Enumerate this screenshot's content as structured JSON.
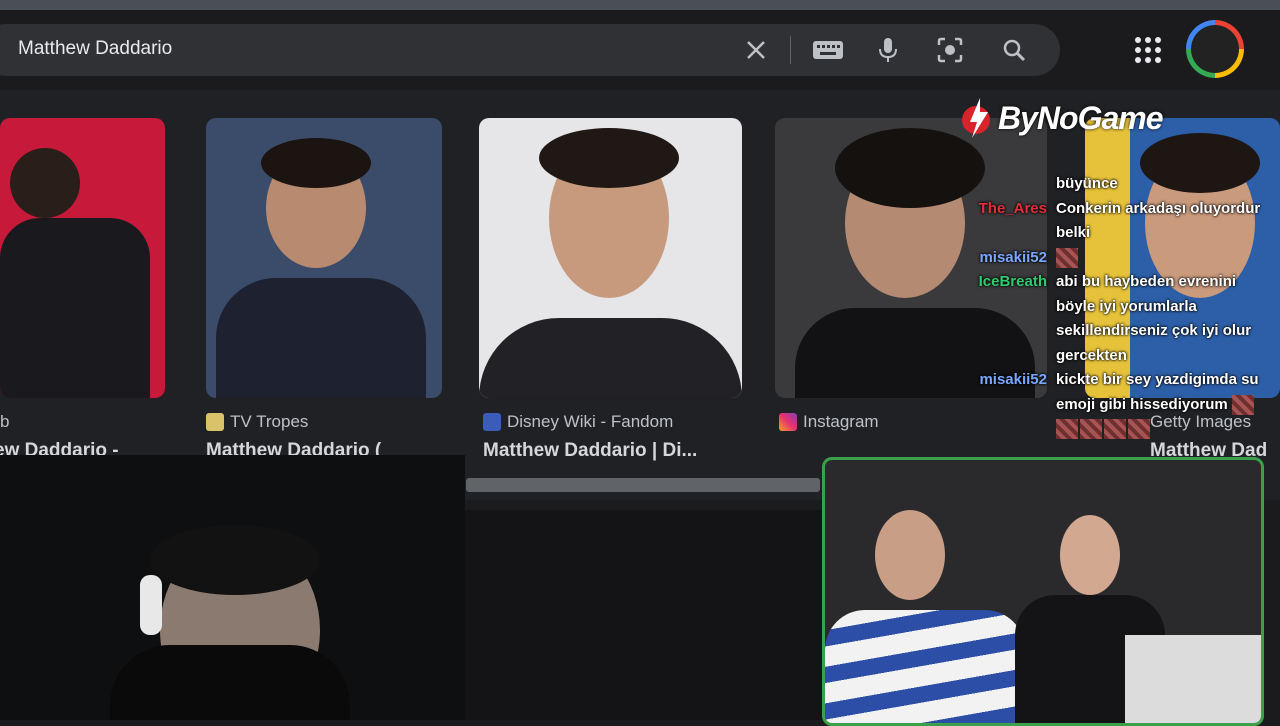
{
  "search": {
    "query": "Matthew Daddario",
    "icons": [
      "close-icon",
      "keyboard-icon",
      "mic-icon",
      "lens-icon",
      "search-icon"
    ]
  },
  "header": {
    "apps_icon": "apps-grid-icon"
  },
  "results": [
    {
      "source": "b",
      "title": "ew Daddario -"
    },
    {
      "source": "TV Tropes",
      "title": "Matthew Daddario ("
    },
    {
      "source": "Disney Wiki - Fandom",
      "title": "Matthew Daddario | Di..."
    },
    {
      "source": "Instagram",
      "title": ""
    },
    {
      "source": "Getty Images",
      "title": "Matthew Dad"
    }
  ],
  "overlay": {
    "logo": "ByNoGame"
  },
  "chat": [
    {
      "user": "",
      "message": "büyünce",
      "color": "#ffffff"
    },
    {
      "user": "The_Ares",
      "message": "Conkerin arkadaşı oluyordur",
      "color": "#e0303a"
    },
    {
      "user": "",
      "message": "belki",
      "color": "#ffffff"
    },
    {
      "user": "misakii52",
      "message": "",
      "color": "#7aa7ff",
      "emotes": 1
    },
    {
      "user": "IceBreath",
      "message": "abi bu haybeden evrenini",
      "color": "#2ecc71"
    },
    {
      "user": "",
      "message": "böyle iyi yorumlarla",
      "color": "#ffffff"
    },
    {
      "user": "",
      "message": "sekillendirseniz çok iyi olur",
      "color": "#ffffff"
    },
    {
      "user": "",
      "message": "gercekten",
      "color": "#ffffff"
    },
    {
      "user": "misakii52",
      "message": "kickte bir sey yazdigimda su",
      "color": "#7aa7ff"
    },
    {
      "user": "",
      "message": "emoji gibi hissediyorum",
      "color": "#ffffff",
      "emotes_after": 1
    },
    {
      "user": "",
      "message": "",
      "color": "#ffffff",
      "emotes": 4
    }
  ]
}
